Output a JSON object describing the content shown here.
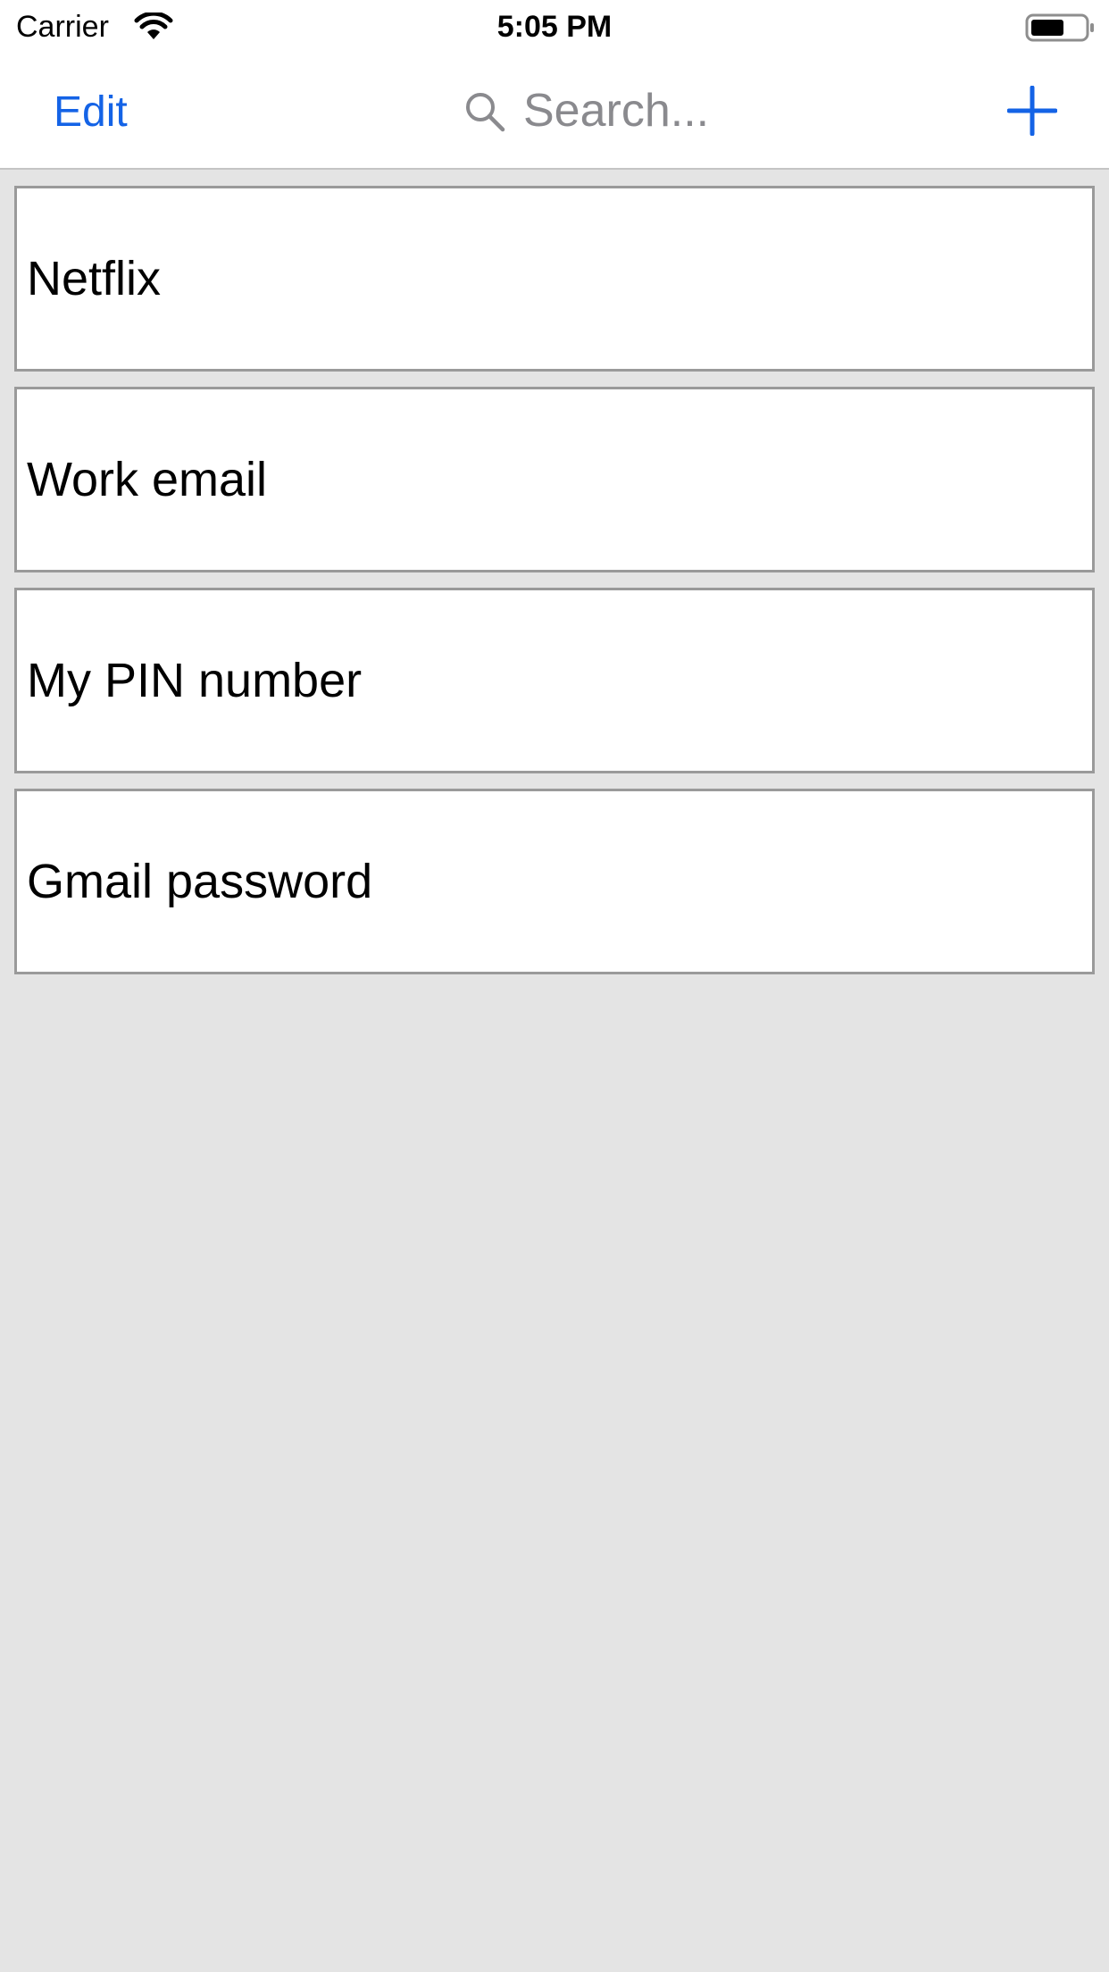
{
  "status_bar": {
    "carrier": "Carrier",
    "time": "5:05 PM",
    "wifi_icon": "wifi-icon",
    "battery_icon": "battery-icon"
  },
  "nav_bar": {
    "edit_label": "Edit",
    "search": {
      "placeholder": "Search...",
      "value": "",
      "icon": "search-icon"
    },
    "add_icon": "plus-icon"
  },
  "colors": {
    "accent": "#1463e6",
    "background": "#e4e4e4",
    "card": "#ffffff",
    "card_border": "#9a9a9a",
    "placeholder": "#8a8a8e"
  },
  "items": [
    {
      "label": "Netflix"
    },
    {
      "label": "Work email"
    },
    {
      "label": "My PIN number"
    },
    {
      "label": "Gmail password"
    }
  ]
}
